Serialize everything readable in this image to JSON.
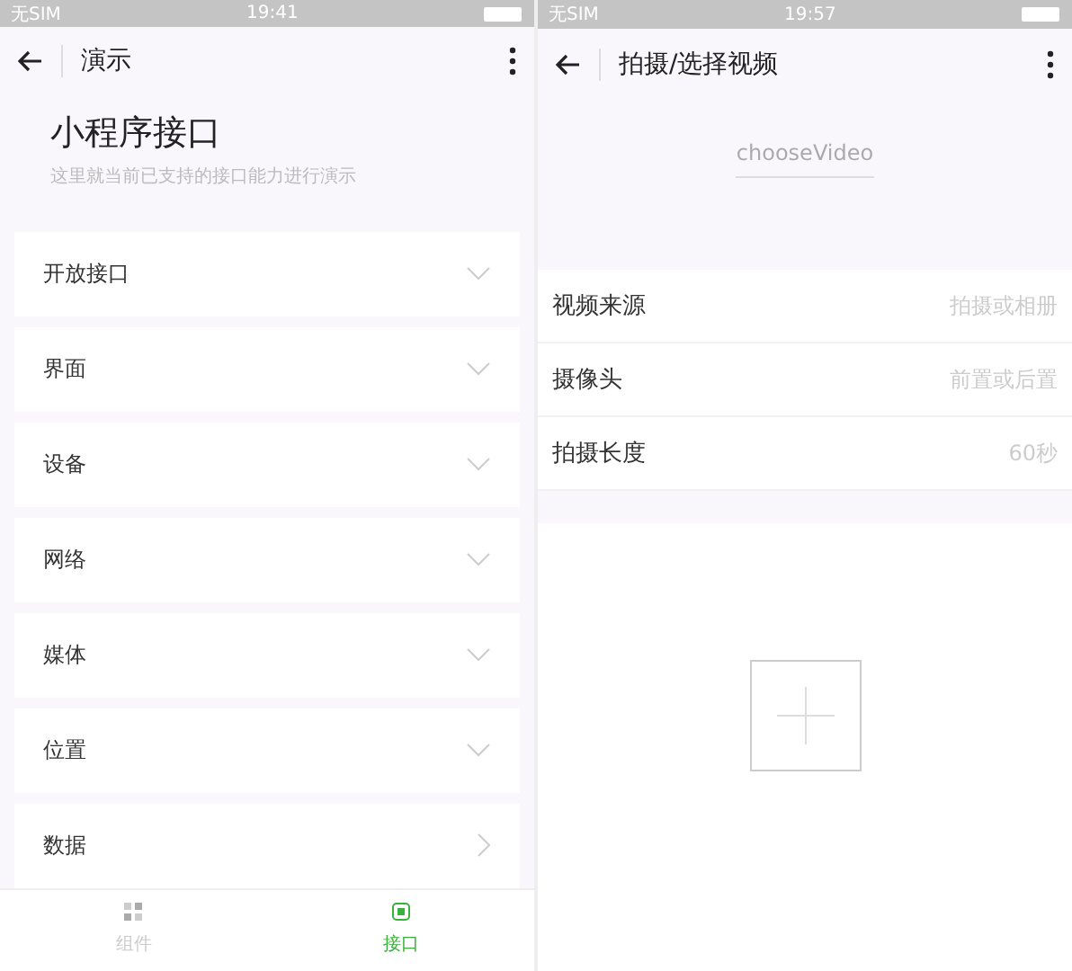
{
  "screens": [
    {
      "status_bar": {
        "carrier": "无SIM",
        "time": "19:41"
      },
      "nav": {
        "title": "演示"
      },
      "header": {
        "title": "小程序接口",
        "subtitle": "这里就当前已支持的接口能力进行演示"
      },
      "items": [
        {
          "label": "开放接口",
          "kind": "accordion"
        },
        {
          "label": "界面",
          "kind": "accordion"
        },
        {
          "label": "设备",
          "kind": "accordion"
        },
        {
          "label": "网络",
          "kind": "accordion"
        },
        {
          "label": "媒体",
          "kind": "accordion"
        },
        {
          "label": "位置",
          "kind": "accordion"
        },
        {
          "label": "数据",
          "kind": "link"
        }
      ],
      "tab_bar": [
        {
          "label": "组件",
          "selected": false
        },
        {
          "label": "接口",
          "selected": true
        }
      ]
    },
    {
      "status_bar": {
        "carrier": "无SIM",
        "time": "19:57"
      },
      "nav": {
        "title": "拍摄/选择视频"
      },
      "api_name": "chooseVideo",
      "form_rows": [
        {
          "label": "视频来源",
          "value": "拍摄或相册"
        },
        {
          "label": "摄像头",
          "value": "前置或后置"
        },
        {
          "label": "拍摄长度",
          "value": "60秒"
        }
      ]
    }
  ]
}
